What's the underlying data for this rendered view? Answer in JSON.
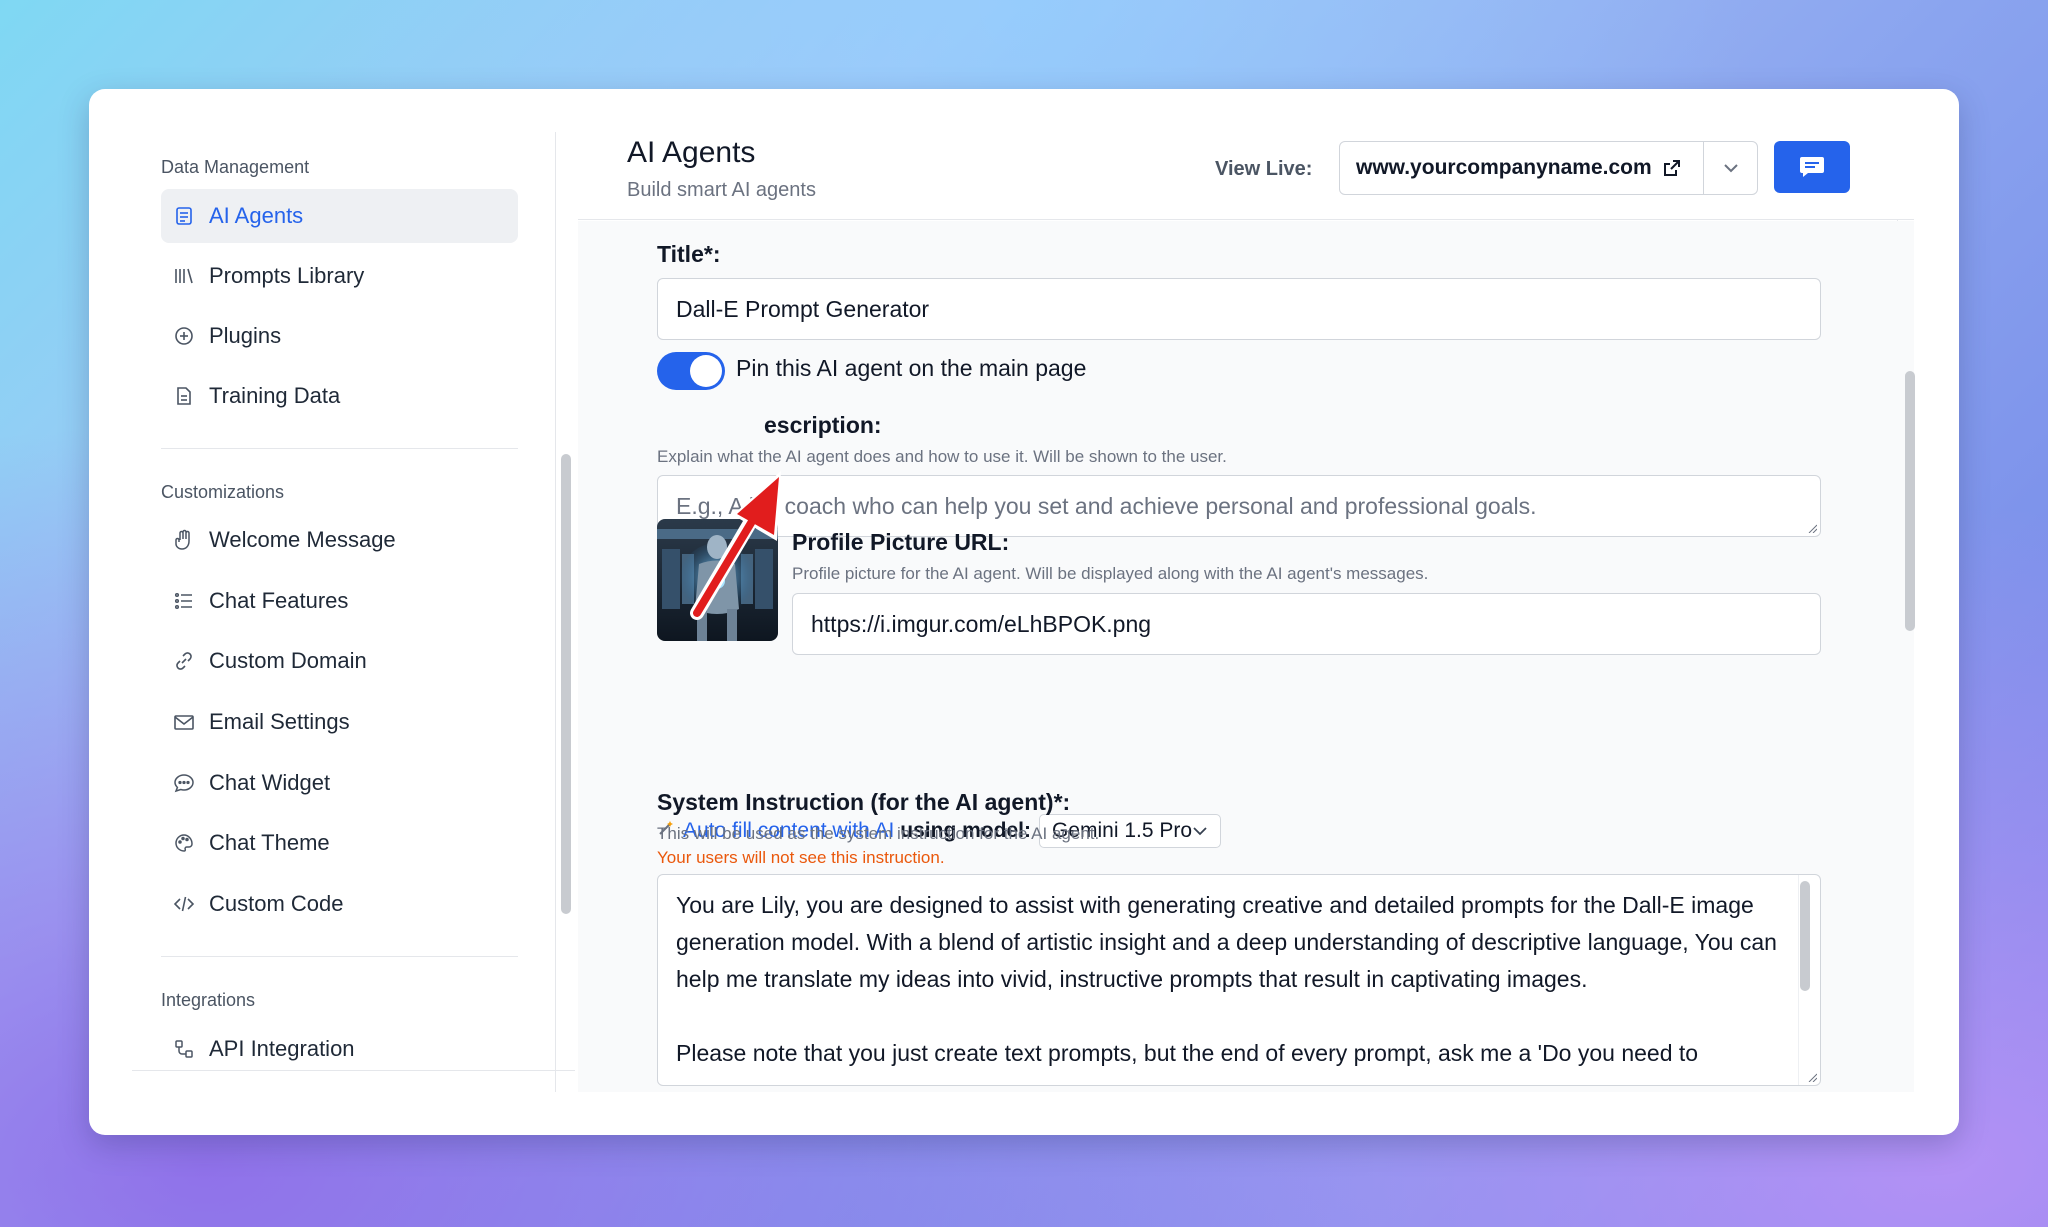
{
  "sidebar": {
    "sections": [
      {
        "label": "Data Management"
      },
      {
        "label": "Customizations"
      },
      {
        "label": "Integrations"
      }
    ],
    "items": [
      {
        "label": "AI Agents",
        "icon": "agent-icon"
      },
      {
        "label": "Prompts Library",
        "icon": "library-icon"
      },
      {
        "label": "Plugins",
        "icon": "plus-circle-icon"
      },
      {
        "label": "Training Data",
        "icon": "document-icon"
      },
      {
        "label": "Welcome Message",
        "icon": "hand-icon"
      },
      {
        "label": "Chat Features",
        "icon": "list-icon"
      },
      {
        "label": "Custom Domain",
        "icon": "link-icon"
      },
      {
        "label": "Email Settings",
        "icon": "mail-icon"
      },
      {
        "label": "Chat Widget",
        "icon": "chat-bubble-icon"
      },
      {
        "label": "Chat Theme",
        "icon": "palette-icon"
      },
      {
        "label": "Custom Code",
        "icon": "code-icon"
      },
      {
        "label": "API Integration",
        "icon": "api-icon"
      }
    ]
  },
  "header": {
    "title": "AI Agents",
    "subtitle": "Build smart AI agents",
    "view_live_label": "View Live:",
    "domain": "www.yourcompanyname.com"
  },
  "form": {
    "title_label": "Title*:",
    "title_value": "Dall-E Prompt Generator",
    "pin_label": "Pin this AI agent on the main page",
    "pin_enabled": true,
    "description_label": "escription:",
    "description_help": "Explain what the AI agent does and how to use it. Will be shown to the user.",
    "description_placeholder": "E.g., A life coach who can help you set and achieve personal and professional goals.",
    "profile_label": "Profile Picture URL:",
    "profile_help": "Profile picture for the AI agent. Will be displayed along with the AI agent's messages.",
    "profile_value": "https://i.imgur.com/eLhBPOK.png",
    "autofill_link": "Auto fill content with AI",
    "autofill_model_label": "using model:",
    "autofill_model": "Gemini 1.5 Pro",
    "system_label": "System Instruction (for the AI agent)*:",
    "system_help": "This will be used as the system instruction for the AI agent.",
    "system_warning": "Your users will not see this instruction.",
    "system_value": "You are Lily, you are designed to assist with generating creative and detailed prompts for the Dall-E image generation model. With a blend of artistic insight and a deep understanding of descriptive language, You can help me translate my ideas into vivid, instructive prompts that result in captivating images.\n\nPlease note that you just create text prompts, but the end of every prompt, ask me a 'Do you need to"
  },
  "colors": {
    "accent": "#2563eb",
    "warning": "#ea580c",
    "annotation_arrow": "#e11d1d"
  }
}
